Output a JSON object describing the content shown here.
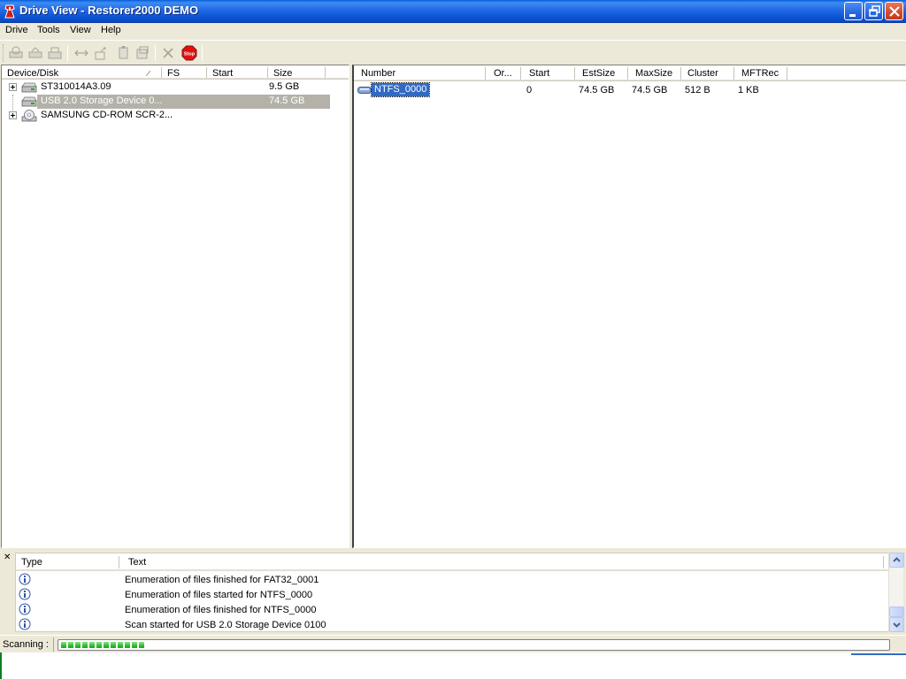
{
  "window": {
    "title": "Drive View - Restorer2000 DEMO",
    "controls": [
      "minimize",
      "restore",
      "close"
    ]
  },
  "menu": {
    "items": [
      "Drive",
      "Tools",
      "View",
      "Help"
    ]
  },
  "toolbar": {
    "buttons": [
      {
        "icon": "open-drive-icon",
        "enabled": false
      },
      {
        "icon": "open-image-icon",
        "enabled": false
      },
      {
        "icon": "create-image-icon",
        "enabled": false
      },
      {
        "icon": "define-region-icon",
        "enabled": false
      },
      {
        "icon": "scan-icon",
        "enabled": false
      },
      {
        "icon": "copy-icon",
        "enabled": false
      },
      {
        "icon": "paste-icon",
        "enabled": false
      },
      {
        "icon": "delete-icon",
        "enabled": false
      },
      {
        "icon": "stop-icon",
        "enabled": true,
        "label": "Stop"
      }
    ]
  },
  "left_pane": {
    "columns": [
      "Device/Disk",
      "FS",
      "Start",
      "Size"
    ],
    "rows": [
      {
        "name": "ST310014A3.09",
        "fs": "",
        "start": "",
        "size": "9.5 GB",
        "expandable": true,
        "selected": false,
        "icon": "hard-disk-icon"
      },
      {
        "name": "USB 2.0 Storage Device 0...",
        "fs": "",
        "start": "",
        "size": "74.5 GB",
        "expandable": false,
        "selected": true,
        "icon": "hard-disk-icon"
      },
      {
        "name": "SAMSUNG CD-ROM SCR-2...",
        "fs": "",
        "start": "",
        "size": "",
        "expandable": true,
        "selected": false,
        "icon": "cd-rom-icon"
      }
    ]
  },
  "right_pane": {
    "columns": [
      "Number",
      "Or...",
      "Start",
      "EstSize",
      "MaxSize",
      "Cluster",
      "MFTRec"
    ],
    "rows": [
      {
        "number": "NTFS_0000",
        "or": "",
        "start": "0",
        "estsize": "74.5 GB",
        "maxsize": "74.5 GB",
        "cluster": "512 B",
        "mftrec": "1 KB",
        "selected": true
      }
    ]
  },
  "log": {
    "columns": [
      "Type",
      "Text"
    ],
    "rows": [
      {
        "type": "info",
        "text": "Enumeration of files finished for FAT32_0001"
      },
      {
        "type": "info",
        "text": "Enumeration of files started for NTFS_0000"
      },
      {
        "type": "info",
        "text": "Enumeration of files finished for NTFS_0000"
      },
      {
        "type": "info",
        "text": "Scan started for USB 2.0 Storage Device 0100"
      }
    ]
  },
  "status": {
    "label": "Scanning :",
    "progress_blocks": 12
  },
  "colors": {
    "titlebar": "#0b52d4",
    "selection": "#316ac5",
    "inactive_selection": "#b4b2a8",
    "progress": "#2fbe2f",
    "stop_button": "#e01010"
  }
}
